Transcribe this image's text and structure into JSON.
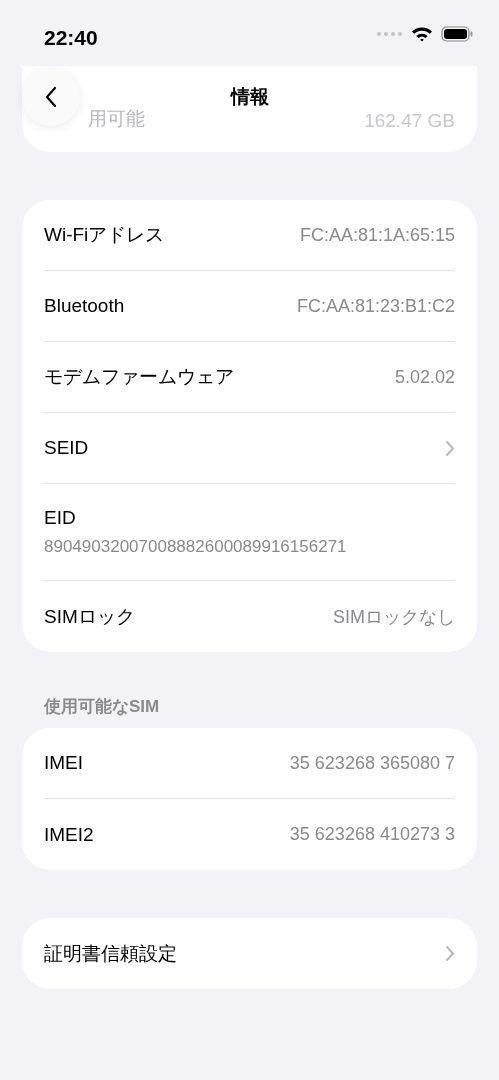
{
  "status_bar": {
    "time": "22:40"
  },
  "nav": {
    "title": "情報"
  },
  "storage_row": {
    "label": "用可能",
    "value": "162.47 GB"
  },
  "network_list": [
    {
      "kind": "value",
      "label": "Wi-Fiアドレス",
      "value": "FC:AA:81:1A:65:15"
    },
    {
      "kind": "value",
      "label": "Bluetooth",
      "value": "FC:AA:81:23:B1:C2"
    },
    {
      "kind": "value",
      "label": "モデムファームウェア",
      "value": "5.02.02"
    },
    {
      "kind": "chevron",
      "label": "SEID"
    },
    {
      "kind": "stacked",
      "label": "EID",
      "value": "89049032007008882600089916156271"
    },
    {
      "kind": "value",
      "label": "SIMロック",
      "value": "SIMロックなし"
    }
  ],
  "sim_section": {
    "title": "使用可能なSIM",
    "rows": [
      {
        "kind": "value",
        "label": "IMEI",
        "value": "35 623268 365080 7"
      },
      {
        "kind": "value",
        "label": "IMEI2",
        "value": "35 623268 410273 3"
      }
    ]
  },
  "certificate_list": [
    {
      "kind": "chevron",
      "label": "証明書信頼設定"
    }
  ]
}
